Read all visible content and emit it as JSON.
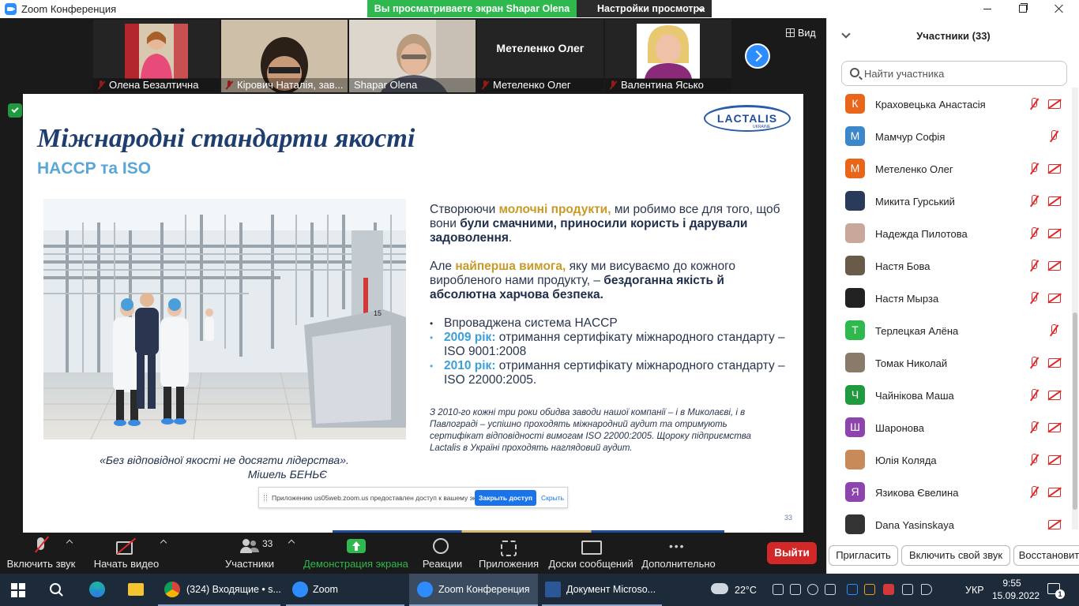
{
  "window": {
    "title": "Zoom Конференция"
  },
  "share_banner": {
    "text": "Вы просматриваете экран Shapar Olena",
    "view_settings": "Настройки просмотра"
  },
  "video_strip": {
    "tiles": [
      {
        "name": "Олена Безалтична",
        "muted": true
      },
      {
        "name": "Кірович Наталія, зав...",
        "muted": true
      },
      {
        "name": "Shapar Olena",
        "muted": false,
        "active": true
      },
      {
        "name": "Метеленко Олег",
        "muted": true,
        "big_name": "Метеленко Олег"
      },
      {
        "name": "Валентина Ясько",
        "muted": true
      }
    ],
    "view_label": "Вид"
  },
  "slide": {
    "title": "Міжнародні стандарти якості",
    "subtitle": "HACCP та ISO",
    "logo_text": "LACTALIS",
    "logo_sub": "UKRAINE",
    "para1": {
      "t1": "Створюючи ",
      "h1": "молочні продукти,",
      "t2": " ми робимо все для того, щоб вони ",
      "b1": "були смачними, приносили користь і дарували задоволення",
      "t3": "."
    },
    "para2": {
      "t1": "Але ",
      "h1": "найперша вимога,",
      "t2": " яку ми висуваємо до кожного виробленого нами продукту, – ",
      "b1": "бездоганна якість й абсолютна харчова безпека."
    },
    "bullets": [
      {
        "year": "",
        "text": "Впроваджена система HACCP"
      },
      {
        "year": "2009 рік:",
        "text": " отримання сертифікату міжнародного стандарту –  ISO 9001:2008"
      },
      {
        "year": "2010 рік:",
        "text": " отримання сертифікату міжнародного стандарту – ISO 22000:2005."
      }
    ],
    "note": "З 2010-го кожні три роки обидва заводи нашої компанії – і в Миколаєві, і в Павлограді – успішно проходять міжнародний аудит та отримують сертифікат відповідності вимогам ISO 22000:2005. Щороку підприємства Lactalis в Україні проходять наглядовий аудит.",
    "quote": "«Без відповідної якості не досягти лідерства».",
    "quote_author": "Мішель БЕНЬЄ",
    "page_number": "33"
  },
  "access_bar": {
    "message": "Приложению us05web.zoom.us предоставлен доступ к вашему экрану.",
    "stop_label": "Закрыть доступ",
    "hide_label": "Скрыть"
  },
  "toolbar": {
    "audio": "Включить звук",
    "video": "Начать видео",
    "participants": "Участники",
    "participants_count": "33",
    "share": "Демонстрация экрана",
    "reactions": "Реакции",
    "apps": "Приложения",
    "whiteboards": "Доски сообщений",
    "more": "Дополнительно",
    "leave": "Выйти"
  },
  "panel": {
    "title": "Участники (33)",
    "search_placeholder": "Найти участника",
    "participants": [
      {
        "name": "Краховецька Анастасія",
        "initial": "К",
        "color": "#e8651a",
        "mic_off": true,
        "cam_off": true
      },
      {
        "name": "Мамчур Софія",
        "initial": "М",
        "color": "#3b87c9",
        "mic_off": true,
        "cam_off": false
      },
      {
        "name": "Метеленко Олег",
        "initial": "М",
        "color": "#e8651a",
        "mic_off": true,
        "cam_off": true
      },
      {
        "name": "Микита Гурський",
        "initial": "",
        "color": "#2a3a5a",
        "mic_off": true,
        "cam_off": true
      },
      {
        "name": "Надежда Пилотова",
        "initial": "",
        "color": "#c9a79a",
        "mic_off": true,
        "cam_off": true
      },
      {
        "name": "Настя Бова",
        "initial": "",
        "color": "#6a5a4a",
        "mic_off": true,
        "cam_off": true
      },
      {
        "name": "Настя Мырза",
        "initial": "",
        "color": "#222222",
        "mic_off": true,
        "cam_off": true
      },
      {
        "name": "Терлецкая Алёна",
        "initial": "Т",
        "color": "#2eb84d",
        "mic_off": true,
        "cam_off": false
      },
      {
        "name": "Томак Николай",
        "initial": "",
        "color": "#8a7a6a",
        "mic_off": true,
        "cam_off": true
      },
      {
        "name": "Чайнікова Маша",
        "initial": "Ч",
        "color": "#1f9a3f",
        "mic_off": true,
        "cam_off": true
      },
      {
        "name": "Шаронова",
        "initial": "Ш",
        "color": "#8e44ad",
        "mic_off": true,
        "cam_off": true
      },
      {
        "name": "Юлія Коляда",
        "initial": "",
        "color": "#c98a5a",
        "mic_off": true,
        "cam_off": true
      },
      {
        "name": "Язикова Євелина",
        "initial": "Я",
        "color": "#8e44ad",
        "mic_off": true,
        "cam_off": true
      },
      {
        "name": "Dana Yasinskaya",
        "initial": "",
        "color": "#333333",
        "mic_off": false,
        "cam_off": true
      }
    ],
    "actions": {
      "invite": "Пригласить",
      "unmute_me": "Включить свой звук",
      "reclaim": "Восстановит"
    }
  },
  "taskbar": {
    "apps": [
      {
        "label": "(324) Входящие • s..."
      },
      {
        "label": "Zoom"
      },
      {
        "label": "Zoom Конференция"
      },
      {
        "label": "Документ Microso..."
      }
    ],
    "temperature": "22°C",
    "language": "УКР",
    "time": "9:55",
    "date": "15.09.2022",
    "notifications": "1"
  }
}
